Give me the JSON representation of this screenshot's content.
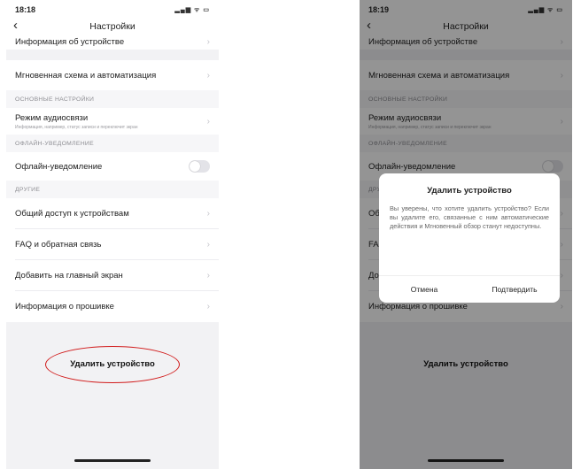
{
  "status": {
    "time_left": "18:18",
    "time_right": "18:19",
    "icons": "▂▄▆ ᯤ ▭"
  },
  "nav": {
    "back": "‹",
    "title": "Настройки"
  },
  "rows": {
    "device_info": "Информация об устройстве",
    "scheme": "Мгновенная схема и автоматизация",
    "section_basic": "ОСНОВНЫЕ НАСТРОЙКИ",
    "audio": "Режим аудиосвязи",
    "audio_sub": "Информация, например, статус записи и переключит экран",
    "section_offline": "ОФЛАЙН-УВЕДОМЛЕНИЕ",
    "offline": "Офлайн-уведомление",
    "section_other": "ДРУГИЕ",
    "sharing": "Общий доступ к устройствам",
    "faq": "FAQ и обратная связь",
    "home": "Добавить на главный экран",
    "firmware": "Информация о прошивке",
    "delete": "Удалить устройство"
  },
  "dialog": {
    "title": "Удалить устройство",
    "text": "Вы уверены, что хотите удалить устройство? Если вы удалите его, связанные с ним автоматические действия и Мгновенный обзор станут недоступны.",
    "cancel": "Отмена",
    "confirm": "Подтвердить"
  },
  "offline_toggle_on": false,
  "colors": {
    "highlight_oval": "#d11a1a",
    "overlay": "rgba(0,0,0,0.42)"
  }
}
